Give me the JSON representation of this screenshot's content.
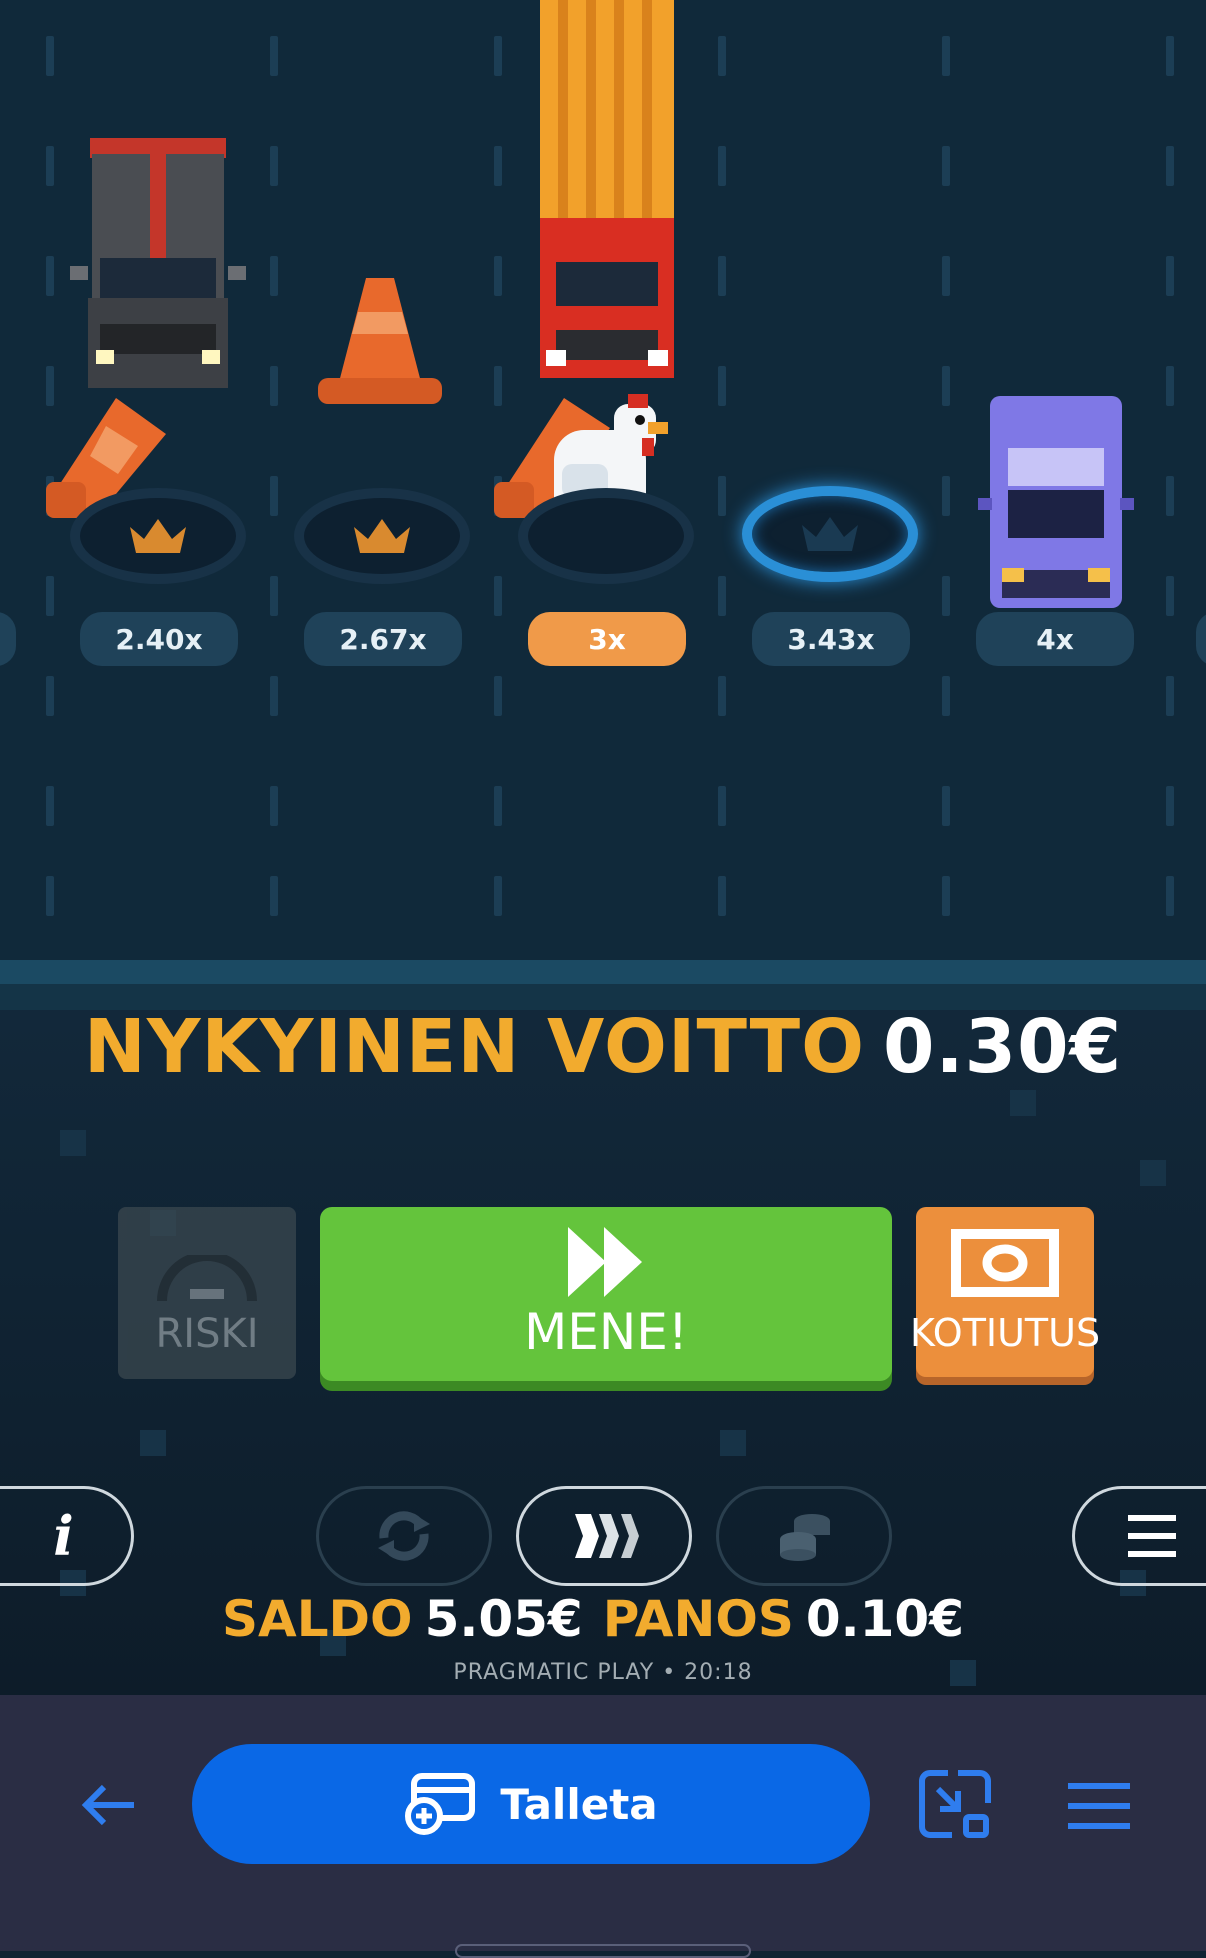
{
  "lanes": {
    "multipliers": [
      "2.40x",
      "2.67x",
      "3x",
      "3.43x",
      "4x"
    ],
    "current_index": 2,
    "next_index": 3
  },
  "current_win": {
    "label": "NYKYINEN VOITTO",
    "value": "0.30€"
  },
  "buttons": {
    "risk_label": "RISKI",
    "go_label": "MENE!",
    "cashout_label": "KOTIUTUS"
  },
  "toolbar": {
    "info_label": "i"
  },
  "status": {
    "balance_label": "SALDO",
    "balance_value": "5.05€",
    "bet_label": "PANOS",
    "bet_value": "0.10€",
    "provider_time": "PRAGMATIC PLAY • 20:18"
  },
  "browser_bar": {
    "deposit_label": "Talleta"
  },
  "colors": {
    "accent_orange": "#f09a49",
    "go_green": "#64c43c",
    "label_gold": "#f2ab2e",
    "deposit_blue": "#0a68e6"
  }
}
